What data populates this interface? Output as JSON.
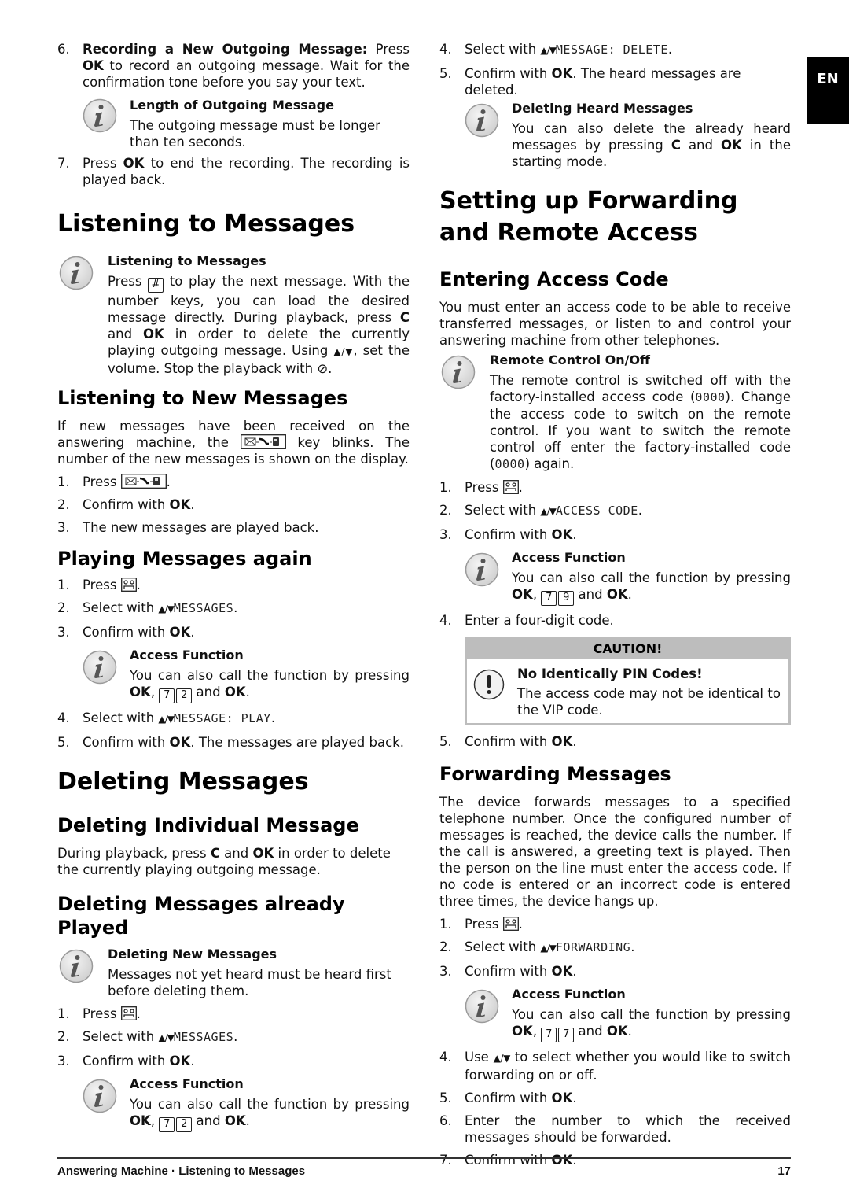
{
  "side_tab": "EN",
  "left": {
    "intro_steps": [
      {
        "num": "6.",
        "lead": "Recording a New Outgoing Message:",
        "text1": " Press ",
        "ok": "OK",
        "text2": " to record an outgoing message. Wait for the confirmation tone before you say your text."
      },
      {
        "num": "7.",
        "text1": "Press ",
        "ok": "OK",
        "text2": " to end the recording. The recording is played back."
      }
    ],
    "note_outgoing": {
      "title": "Length of Outgoing Message",
      "text": "The outgoing message must be longer than ten seconds."
    },
    "h1_listening": "Listening to Messages",
    "note_listening": {
      "title": "Listening to Messages",
      "t1": "Press ",
      "key_hash": "#",
      "t2": " to play the next message. With the number keys, you can load the desired message directly. During playback, press ",
      "c": "C",
      "t3": " and ",
      "ok": "OK",
      "t4": " in order to delete the currently playing outgoing message. Using ",
      "arrows": "▲/▼",
      "t5": ", set the volume. Stop the playback with ",
      "stop_symbol": "⊘",
      "t6": "."
    },
    "h2_new": "Listening to New Messages",
    "new_para": {
      "t1": "If new messages have been received on the answering machine, the ",
      "key": "✉-↘-▯",
      "t2": " key blinks. The number of the new messages is shown on the display."
    },
    "new_steps": [
      {
        "num": "1.",
        "t1": "Press ",
        "key": "✉-↘-▯",
        "t2": "."
      },
      {
        "num": "2.",
        "t1": "Confirm with ",
        "ok": "OK",
        "t2": "."
      },
      {
        "num": "3.",
        "t1": "The new messages are played back."
      }
    ],
    "h2_again": "Playing Messages again",
    "again_steps": [
      {
        "num": "1.",
        "t1": "Press ",
        "key": "▭",
        "t2": "."
      },
      {
        "num": "2.",
        "t1": "Select with ",
        "arrows": "▲/▼",
        "lcd": "MESSAGES",
        "t2": "."
      },
      {
        "num": "3.",
        "t1": "Confirm with ",
        "ok": "OK",
        "t2": "."
      },
      {
        "num": "4.",
        "t1": "Select with ",
        "arrows": "▲/▼",
        "lcd": "MESSAGE: PLAY",
        "t2": "."
      },
      {
        "num": "5.",
        "t1": "Confirm with ",
        "ok": "OK",
        "t2": ". The messages are played back."
      }
    ],
    "note_access_again": {
      "title": "Access Function",
      "t1": "You can also call the function by pressing ",
      "ok": "OK",
      "t2": ", ",
      "k1": "7",
      "k2": "2",
      "t3": " and ",
      "ok2": "OK",
      "t4": "."
    },
    "h1_deleting": "Deleting Messages",
    "h2_individual": "Deleting Individual Message",
    "individual_para": {
      "t1": "During playback, press ",
      "c": "C",
      "t2": " and ",
      "ok": "OK",
      "t3": " in order to delete the currently playing outgoing message."
    },
    "h2_played": "Deleting Messages already Played",
    "note_delete_new": {
      "title": "Deleting New Messages",
      "text": "Messages not yet heard must be heard first before deleting them."
    },
    "played_steps": [
      {
        "num": "1.",
        "t1": "Press ",
        "key": "▭",
        "t2": "."
      },
      {
        "num": "2.",
        "t1": "Select with ",
        "arrows": "▲/▼",
        "lcd": "MESSAGES",
        "t2": "."
      },
      {
        "num": "3.",
        "t1": "Confirm with ",
        "ok": "OK",
        "t2": "."
      }
    ],
    "note_access_played": {
      "title": "Access Function",
      "t1": "You can also call the function by pressing ",
      "ok": "OK",
      "t2": ", ",
      "k1": "7",
      "k2": "2",
      "t3": " and ",
      "ok2": "OK",
      "t4": "."
    }
  },
  "right": {
    "top_steps": [
      {
        "num": "4.",
        "t1": "Select with ",
        "arrows": "▲/▼",
        "lcd": "MESSAGE: DELETE",
        "t2": "."
      },
      {
        "num": "5.",
        "t1": "Confirm with ",
        "ok": "OK",
        "t2": ". The heard messages are deleted."
      }
    ],
    "note_heard": {
      "title": "Deleting Heard Messages",
      "t1": "You can also delete the already heard messages by pressing ",
      "c": "C",
      "t2": " and ",
      "ok": "OK",
      "t3": " in the starting mode."
    },
    "h1_forwarding": "Setting up Forwarding and Remote Access",
    "h2_access": "Entering Access Code",
    "access_para": "You must enter an access code to be able to receive transferred messages, or listen to and control your answering machine from other telephones.",
    "note_remote": {
      "title": "Remote Control On/Off",
      "t1": "The remote control is switched off with the factory-installed access code (",
      "code": "0000",
      "t2": "). Change the access code to switch on the remote control. If you want to switch the remote control off enter the factory-installed code (",
      "code2": "0000",
      "t3": ") again."
    },
    "access_steps": [
      {
        "num": "1.",
        "t1": "Press ",
        "key": "▭",
        "t2": "."
      },
      {
        "num": "2.",
        "t1": "Select with ",
        "arrows": "▲/▼",
        "lcd": "ACCESS CODE",
        "t2": "."
      },
      {
        "num": "3.",
        "t1": "Confirm with ",
        "ok": "OK",
        "t2": "."
      },
      {
        "num": "4.",
        "t1": "Enter a four-digit code."
      },
      {
        "num": "5.",
        "t1": "Confirm with ",
        "ok": "OK",
        "t2": "."
      }
    ],
    "note_access_code": {
      "title": "Access Function",
      "t1": "You can also call the function by pressing ",
      "ok": "OK",
      "t2": ", ",
      "k1": "7",
      "k2": "9",
      "t3": " and ",
      "ok2": "OK",
      "t4": "."
    },
    "caution": {
      "header": "CAUTION!",
      "title": "No Identically PIN Codes!",
      "text": "The access code may not be identical to the VIP code."
    },
    "h2_fwd": "Forwarding Messages",
    "fwd_para": "The device forwards messages to a specified telephone number. Once the configured number of messages is reached, the device calls the number. If the call is answered, a greeting text is played. Then the person on the line must enter the access code. If no code is entered or an incorrect code is entered three times, the device hangs up.",
    "fwd_steps": [
      {
        "num": "1.",
        "t1": "Press ",
        "key": "▭",
        "t2": "."
      },
      {
        "num": "2.",
        "t1": "Select with ",
        "arrows": "▲/▼",
        "lcd": "FORWARDING",
        "t2": "."
      },
      {
        "num": "3.",
        "t1": "Confirm with ",
        "ok": "OK",
        "t2": "."
      },
      {
        "num": "4.",
        "t1": "Use ",
        "arrows": "▲/▼",
        "t2": " to select whether you would like to switch forwarding on or off."
      },
      {
        "num": "5.",
        "t1": "Confirm with ",
        "ok": "OK",
        "t2": "."
      },
      {
        "num": "6.",
        "t1": "Enter the number to which the received messages should be forwarded."
      },
      {
        "num": "7.",
        "t1": "Confirm with ",
        "ok": "OK",
        "t2": "."
      }
    ],
    "note_access_fwd": {
      "title": "Access Function",
      "t1": "You can also call the function by pressing ",
      "ok": "OK",
      "t2": ", ",
      "k1": "7",
      "k2": "7",
      "t3": " and ",
      "ok2": "OK",
      "t4": "."
    }
  },
  "footer": {
    "section": "Answering Machine · Listening to Messages",
    "page": "17"
  }
}
